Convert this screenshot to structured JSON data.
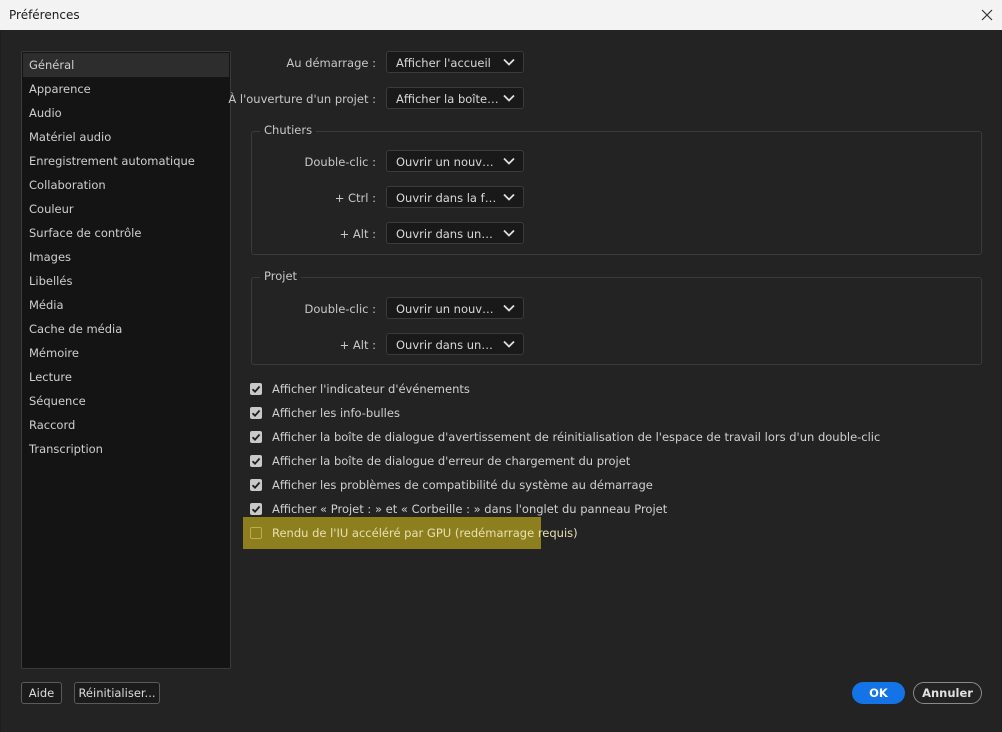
{
  "window": {
    "title": "Préférences"
  },
  "sidebar": {
    "items": [
      {
        "label": "Général",
        "selected": true
      },
      {
        "label": "Apparence"
      },
      {
        "label": "Audio"
      },
      {
        "label": "Matériel audio"
      },
      {
        "label": "Enregistrement automatique"
      },
      {
        "label": "Collaboration"
      },
      {
        "label": "Couleur"
      },
      {
        "label": "Surface de contrôle"
      },
      {
        "label": "Images"
      },
      {
        "label": "Libellés"
      },
      {
        "label": "Média"
      },
      {
        "label": "Cache de média"
      },
      {
        "label": "Mémoire"
      },
      {
        "label": "Lecture"
      },
      {
        "label": "Séquence"
      },
      {
        "label": "Raccord"
      },
      {
        "label": "Transcription"
      }
    ]
  },
  "general": {
    "startup": {
      "label": "Au démarrage :",
      "value": "Afficher l'accueil"
    },
    "open_project": {
      "label": "À l'ouverture d'un projet :",
      "value": "Afficher la boîte de dialogue"
    }
  },
  "chutiers": {
    "title": "Chutiers",
    "double_click": {
      "label": "Double-clic :",
      "value": "Ouvrir un nouvel onglet"
    },
    "ctrl": {
      "label": "+ Ctrl :",
      "value": "Ouvrir dans la fenêtre"
    },
    "alt": {
      "label": "+ Alt :",
      "value": "Ouvrir dans une nouvelle fenêtre"
    }
  },
  "projet": {
    "title": "Projet",
    "double_click": {
      "label": "Double-clic :",
      "value": "Ouvrir un nouvel onglet"
    },
    "alt": {
      "label": "+ Alt :",
      "value": "Ouvrir dans une nouvelle fenêtre"
    }
  },
  "options": [
    {
      "label": "Afficher l'indicateur d'événements",
      "checked": true
    },
    {
      "label": "Afficher les info-bulles",
      "checked": true
    },
    {
      "label": "Afficher la boîte de dialogue d'avertissement de réinitialisation de l'espace de travail lors d'un double-clic",
      "checked": true
    },
    {
      "label": "Afficher la boîte de dialogue d'erreur de chargement du projet",
      "checked": true
    },
    {
      "label": "Afficher les problèmes de compatibilité du système au démarrage",
      "checked": true
    },
    {
      "label": "Afficher « Projet : » et « Corbeille : » dans l'onglet du panneau Projet",
      "checked": true
    },
    {
      "label": "Rendu de l'IU accéléré par GPU (redémarrage requis)",
      "checked": false
    }
  ],
  "buttons": {
    "help": "Aide",
    "reset": "Réinitialiser...",
    "ok": "OK",
    "cancel": "Annuler"
  },
  "colors": {
    "accent": "#1473e6",
    "highlight": "#8d7f1e",
    "background": "#232323"
  }
}
